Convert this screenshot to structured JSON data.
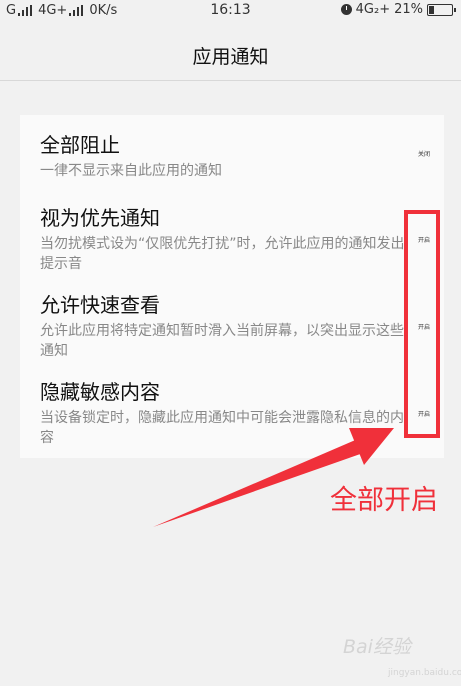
{
  "status_bar": {
    "carrier1": "G",
    "network": "4G+",
    "speed": "0K/s",
    "time": "16:13",
    "network2": "4G₂+",
    "battery": "21%"
  },
  "header": {
    "title": "应用通知"
  },
  "settings": [
    {
      "label": "全部阻止",
      "desc": "一律不显示来自此应用的通知",
      "toggle": "关闭"
    },
    {
      "label": "视为优先通知",
      "desc": "当勿扰模式设为“仅限优先打扰”时，允许此应用的通知发出提示音",
      "toggle": "开启"
    },
    {
      "label": "允许快速查看",
      "desc": "允许此应用将特定通知暂时滑入当前屏幕，以突出显示这些通知",
      "toggle": "开启"
    },
    {
      "label": "隐藏敏感内容",
      "desc": "当设备锁定时，隐藏此应用通知中可能会泄露隐私信息的内容",
      "toggle": "开启"
    }
  ],
  "annotation": {
    "text": "全部开启"
  },
  "watermark": {
    "text": "Bai经验",
    "sub": "jingyan.baidu.com"
  },
  "colors": {
    "accent": "#f0303a",
    "background": "#f1f1f1",
    "card": "#fafafa"
  }
}
